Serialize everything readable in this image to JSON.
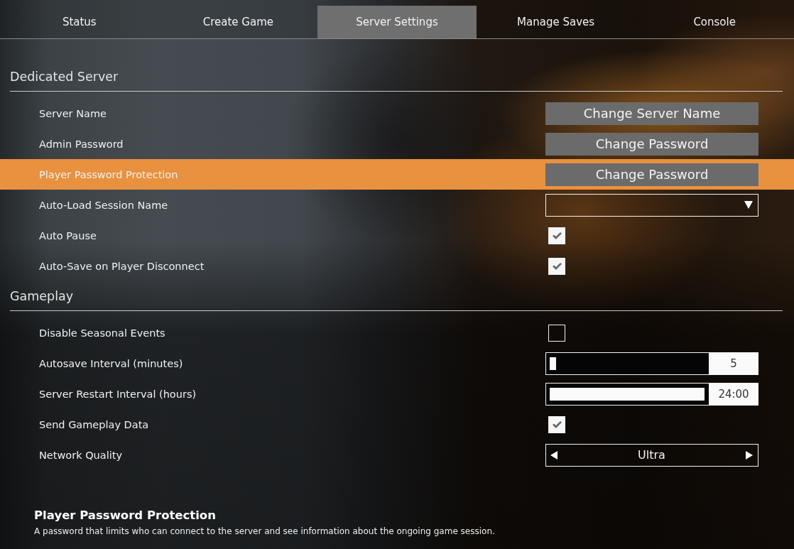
{
  "tabs": [
    {
      "label": "Status",
      "selected": false
    },
    {
      "label": "Create Game",
      "selected": false
    },
    {
      "label": "Server Settings",
      "selected": true
    },
    {
      "label": "Manage Saves",
      "selected": false
    },
    {
      "label": "Console",
      "selected": false
    }
  ],
  "sections": [
    {
      "title": "Dedicated Server",
      "settings": [
        {
          "label": "Server Name",
          "kind": "button",
          "button": "Change Server Name",
          "selected": false
        },
        {
          "label": "Admin Password",
          "kind": "button",
          "button": "Change Password",
          "selected": false
        },
        {
          "label": "Player Password Protection",
          "kind": "button",
          "button": "Change Password",
          "selected": true
        },
        {
          "label": "Auto-Load Session Name",
          "kind": "dropdown",
          "selected": false
        },
        {
          "label": "Auto Pause",
          "kind": "checkbox",
          "checked": true,
          "selected": false
        },
        {
          "label": "Auto-Save on Player Disconnect",
          "kind": "checkbox",
          "checked": true,
          "selected": false
        }
      ]
    },
    {
      "title": "Gameplay",
      "settings": [
        {
          "label": "Disable Seasonal Events",
          "kind": "checkbox",
          "checked": false,
          "selected": false
        },
        {
          "label": "Autosave Interval (minutes)",
          "kind": "slider",
          "level": 0.04,
          "reading": "5",
          "selected": false
        },
        {
          "label": "Server Restart Interval (hours)",
          "kind": "slider",
          "level": 1,
          "reading": "24:00",
          "selected": false
        },
        {
          "label": "Send Gameplay Data",
          "kind": "checkbox",
          "checked": true,
          "selected": false
        },
        {
          "label": "Network Quality",
          "kind": "selector",
          "value": "Ultra",
          "selected": false
        }
      ]
    }
  ],
  "help": {
    "title": "Player Password Protection",
    "text": "A password that limits who can connect to the server and see information about the ongoing game session."
  }
}
